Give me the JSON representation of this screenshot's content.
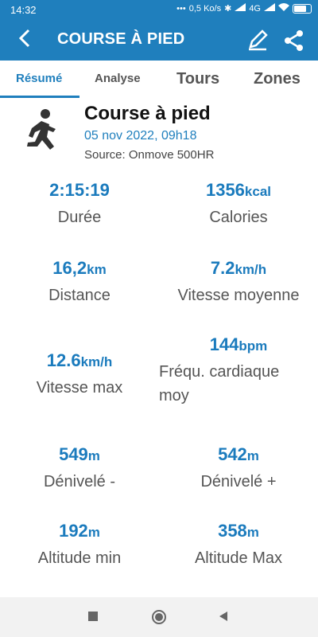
{
  "status_bar": {
    "time": "14:32",
    "speed": "0,5 Ko/s",
    "network": "4G"
  },
  "app_bar": {
    "title": "COURSE À PIED"
  },
  "tabs": [
    {
      "label": "Résumé",
      "active": true
    },
    {
      "label": "Analyse",
      "active": false
    },
    {
      "label": "Tours",
      "active": false
    },
    {
      "label": "Zones",
      "active": false
    }
  ],
  "activity": {
    "title": "Course à pied",
    "date": "05 nov 2022, 09h18",
    "source": "Source: Onmove 500HR"
  },
  "stats": [
    {
      "value": "2:15:19",
      "unit": "",
      "label": "Durée"
    },
    {
      "value": "1356",
      "unit": "kcal",
      "label": "Calories"
    },
    {
      "value": "16,2",
      "unit": "km",
      "label": "Distance"
    },
    {
      "value": "7.2",
      "unit": "km/h",
      "label": "Vitesse moyenne"
    },
    {
      "value": "12.6",
      "unit": "km/h",
      "label": "Vitesse max"
    },
    {
      "value": "144",
      "unit": "bpm",
      "label": "Fréqu. cardiaque moy"
    },
    {
      "value": "549",
      "unit": "m",
      "label": "Dénivelé -"
    },
    {
      "value": "542",
      "unit": "m",
      "label": "Dénivelé +"
    },
    {
      "value": "192",
      "unit": "m",
      "label": "Altitude min"
    },
    {
      "value": "358",
      "unit": "m",
      "label": "Altitude Max"
    }
  ],
  "colors": {
    "primary": "#1f7fbd",
    "value_blue": "#1b7bbd"
  }
}
